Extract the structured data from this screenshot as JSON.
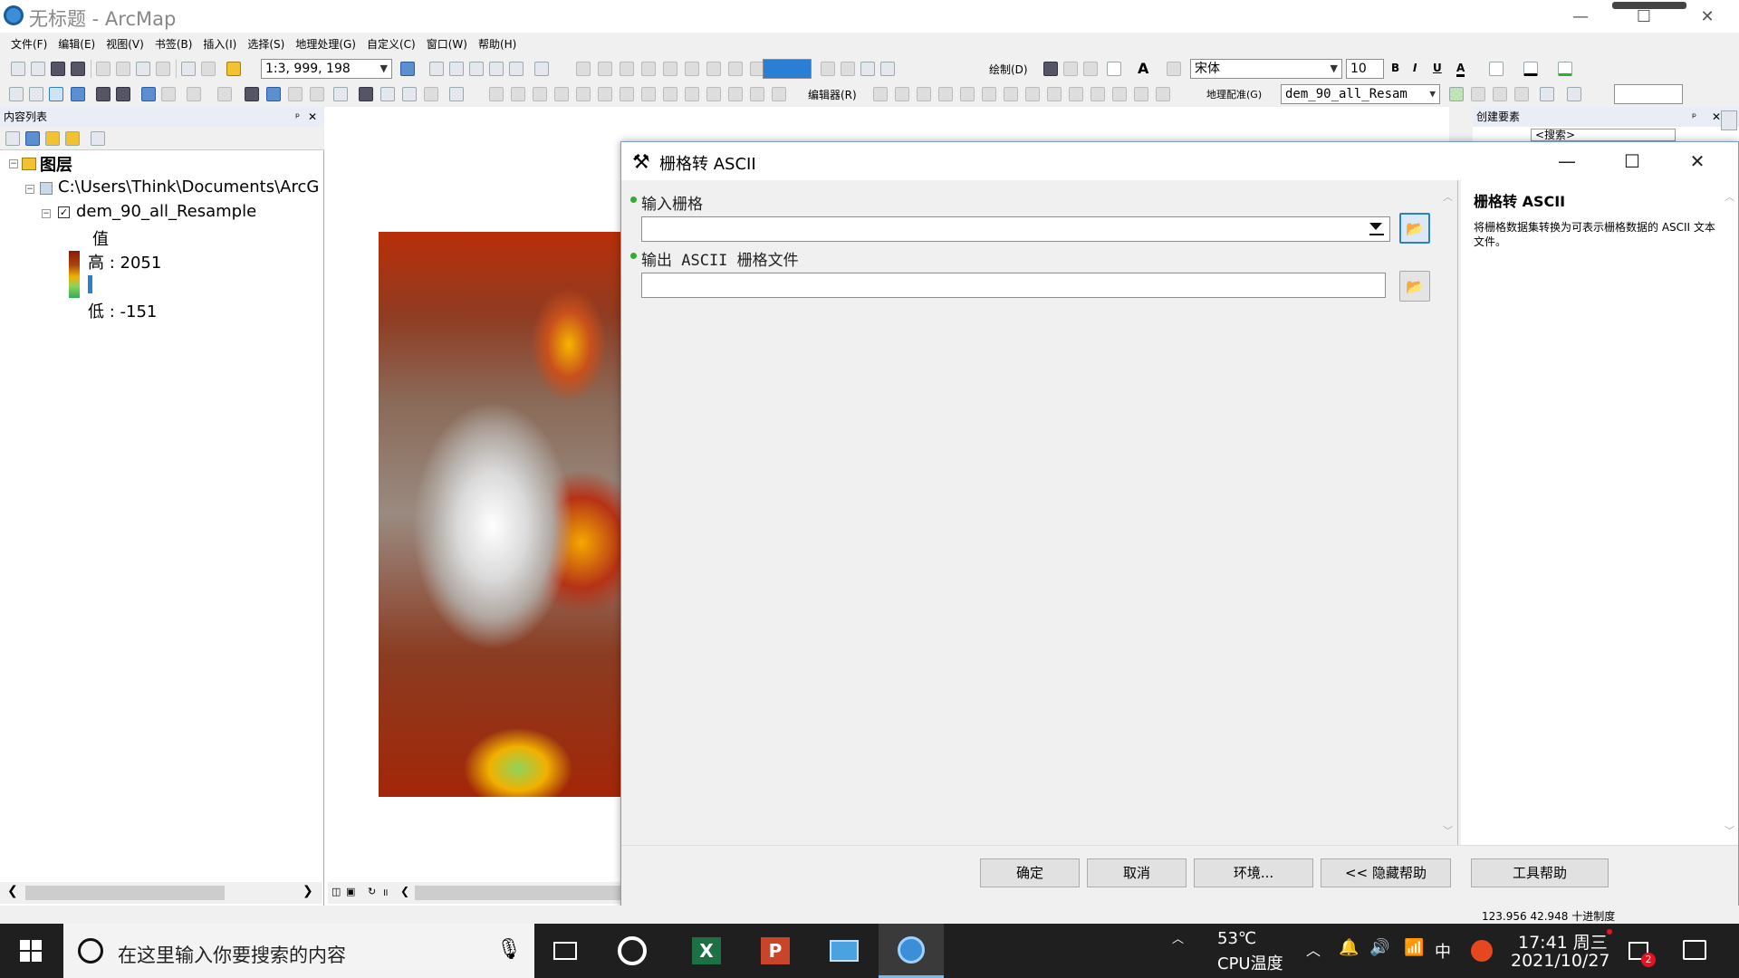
{
  "window": {
    "title": "无标题 - ArcMap",
    "min": "—",
    "max": "☐",
    "close": "✕"
  },
  "menus": [
    "文件(F)",
    "编辑(E)",
    "视图(V)",
    "书签(B)",
    "插入(I)",
    "选择(S)",
    "地理处理(G)",
    "自定义(C)",
    "窗口(W)",
    "帮助(H)"
  ],
  "toolbar": {
    "scale": "1:3, 999, 198",
    "draw_label": "绘制(D)",
    "font_name": "宋体",
    "font_size": "10",
    "bold": "B",
    "italic": "I",
    "underline": "U",
    "font_color": "A",
    "editor_label": "编辑器(R)",
    "georef_label": "地理配准(G)",
    "georef_layer": "dem_90_all_Resam"
  },
  "toc": {
    "title": "内容列表",
    "root": "图层",
    "folder": "C:\\Users\\Think\\Documents\\ArcGIS",
    "layer": "dem_90_all_Resample",
    "value_label": "值",
    "high": "高 : 2051",
    "low": "低 : -151"
  },
  "right_panel": {
    "title": "创建要素",
    "search": "<搜索>"
  },
  "dialog": {
    "title": "栅格转 ASCII",
    "input_label": "输入栅格",
    "input_value": "",
    "output_label": "输出 ASCII 栅格文件",
    "output_value": "",
    "help_title": "栅格转 ASCII",
    "help_body": "将栅格数据集转换为可表示栅格数据的 ASCII 文本文件。",
    "buttons": {
      "ok": "确定",
      "cancel": "取消",
      "env": "环境...",
      "hide_help": "<< 隐藏帮助",
      "tool_help": "工具帮助"
    }
  },
  "status": {
    "coords": "123.956  42.948 十进制度"
  },
  "taskbar": {
    "search_placeholder": "在这里输入你要搜索的内容",
    "cpu_temp": "53℃",
    "cpu_label": "CPU温度",
    "ime": "中",
    "time": "17:41 周三",
    "date": "2021/10/27",
    "notif_count": "2"
  },
  "colors": {
    "accent": "#2f7fc7",
    "dem_high": "#b82e08",
    "dem_low": "#2a7fd4",
    "req_dot": "#2fae2f"
  }
}
